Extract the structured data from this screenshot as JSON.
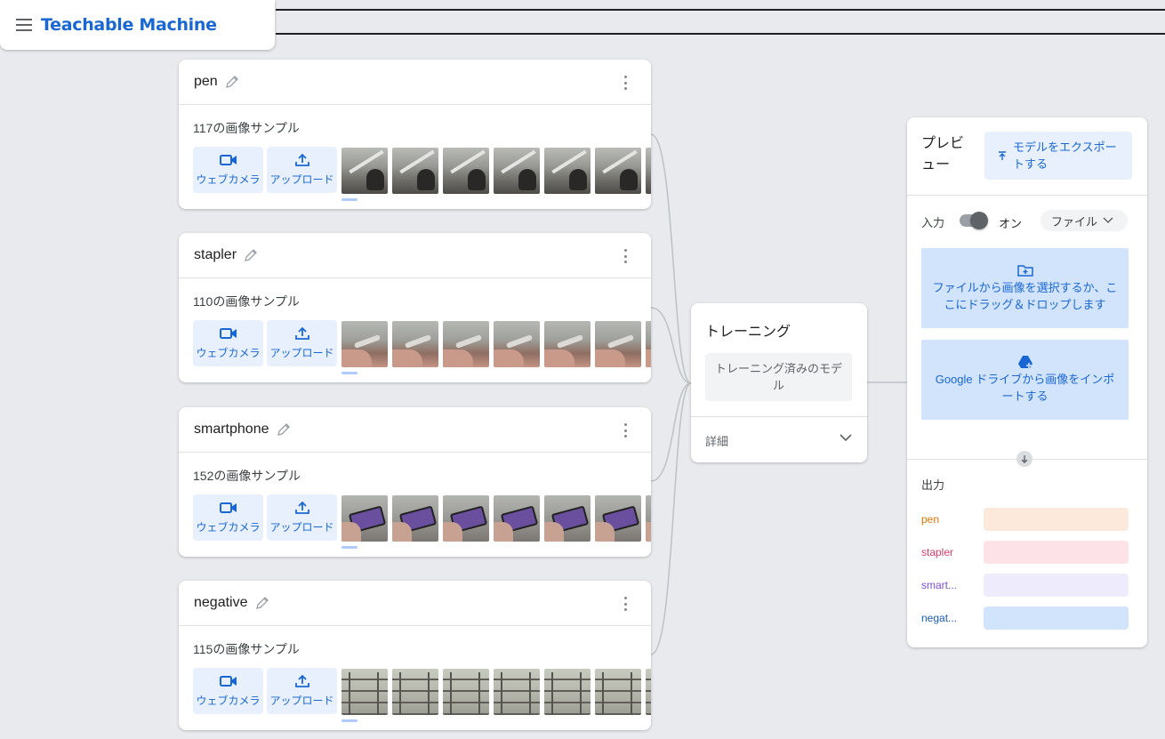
{
  "app": {
    "title": "Teachable Machine"
  },
  "classes": [
    {
      "name": "pen",
      "count": "117の画像サンプル",
      "thumb": "t-pen"
    },
    {
      "name": "stapler",
      "count": "110の画像サンプル",
      "thumb": "t-stapler"
    },
    {
      "name": "smartphone",
      "count": "152の画像サンプル",
      "thumb": "t-phone"
    },
    {
      "name": "negative",
      "count": "115の画像サンプル",
      "thumb": "t-neg"
    }
  ],
  "class_buttons": {
    "webcam": "ウェブカメラ",
    "upload": "アップロード"
  },
  "training": {
    "title": "トレーニング",
    "button": "トレーニング済みのモデル",
    "advanced": "詳細"
  },
  "preview": {
    "title": "プレビュー",
    "export": "モデルをエクスポートする",
    "input_label": "入力",
    "toggle_label": "オン",
    "source_select": "ファイル",
    "file_drop": "ファイルから画像を選択するか、ここにドラッグ＆ドロップします",
    "drive_drop": "Google ドライブから画像をインポートする",
    "output_label": "出力",
    "outputs": [
      {
        "label": "pen",
        "color": "#e37400",
        "bar": "#fde9dc"
      },
      {
        "label": "stapler",
        "color": "#d93c6a",
        "bar": "#fde3e7"
      },
      {
        "label": "smart...",
        "color": "#7b4fd0",
        "bar": "#eeecfc"
      },
      {
        "label": "negat...",
        "color": "#1a5ab8",
        "bar": "#d2e3fc"
      }
    ]
  },
  "colors": {
    "accent": "#1967d2",
    "accent_bg": "#e8f0fe"
  },
  "icons": [
    "menu-icon",
    "pencil-icon",
    "more-vert-icon",
    "videocam-icon",
    "upload-icon",
    "chevron-down-icon",
    "export-icon",
    "folder-add-icon",
    "google-drive-icon",
    "arrow-down-icon"
  ]
}
